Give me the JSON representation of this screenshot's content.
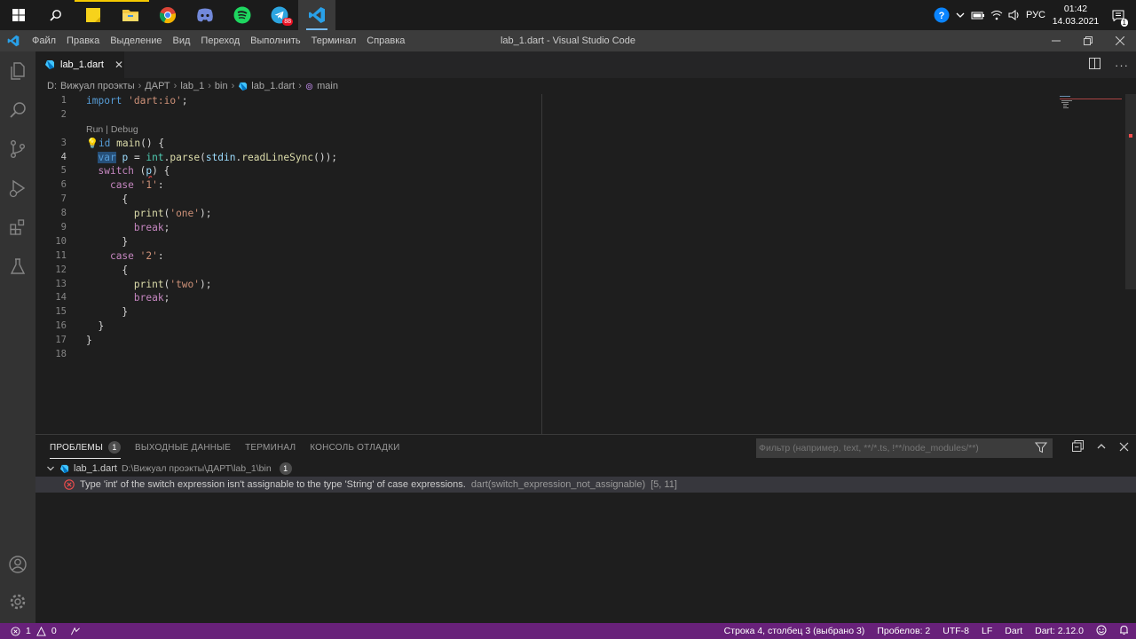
{
  "taskbar": {
    "apps": [
      {
        "name": "start-icon"
      },
      {
        "name": "search-icon"
      },
      {
        "name": "sticky-notes-icon"
      },
      {
        "name": "file-explorer-icon"
      },
      {
        "name": "chrome-icon"
      },
      {
        "name": "discord-icon"
      },
      {
        "name": "spotify-icon"
      },
      {
        "name": "telegram-icon",
        "badge": "88"
      },
      {
        "name": "vscode-icon"
      }
    ],
    "language": "РУС",
    "time": "01:42",
    "date": "14.03.2021",
    "notification_count": "1"
  },
  "titlebar": {
    "menu": [
      "Файл",
      "Правка",
      "Выделение",
      "Вид",
      "Переход",
      "Выполнить",
      "Терминал",
      "Справка"
    ],
    "title": "lab_1.dart - Visual Studio Code"
  },
  "tab": {
    "label": "lab_1.dart"
  },
  "breadcrumb": [
    "D:",
    "Вижуал проэкты",
    "ДАРТ",
    "lab_1",
    "bin",
    "lab_1.dart",
    "main"
  ],
  "codelens": "Run | Debug",
  "line_numbers": [
    "1",
    "2",
    "3",
    "4",
    "5",
    "6",
    "7",
    "8",
    "9",
    "10",
    "11",
    "12",
    "13",
    "14",
    "15",
    "16",
    "17",
    "18"
  ],
  "current_line": "4",
  "panel": {
    "tabs": {
      "problems": "ПРОБЛЕМЫ",
      "problems_count": "1",
      "output": "ВЫХОДНЫЕ ДАННЫЕ",
      "terminal": "ТЕРМИНАЛ",
      "debug_console": "КОНСОЛЬ ОТЛАДКИ"
    },
    "filter_placeholder": "Фильтр (например, text, **/*.ts, !**/node_modules/**)",
    "file": {
      "name": "lab_1.dart",
      "path": "D:\\Вижуал проэкты\\ДАРТ\\lab_1\\bin",
      "count": "1"
    },
    "error": {
      "message": "Type 'int' of the switch expression isn't assignable to the type 'String' of case expressions.",
      "source": "dart(switch_expression_not_assignable)",
      "position": "[5, 11]"
    }
  },
  "statusbar": {
    "errors": "1",
    "warnings": "0",
    "position": "Строка 4, столбец 3 (выбрано 3)",
    "spaces": "Пробелов: 2",
    "encoding": "UTF-8",
    "eol": "LF",
    "language": "Dart",
    "sdk": "Dart: 2.12.0"
  },
  "colors": {
    "statusbar": "#68217a",
    "activitybar": "#333333",
    "editor": "#1e1e1e",
    "error": "#f14c4c"
  }
}
